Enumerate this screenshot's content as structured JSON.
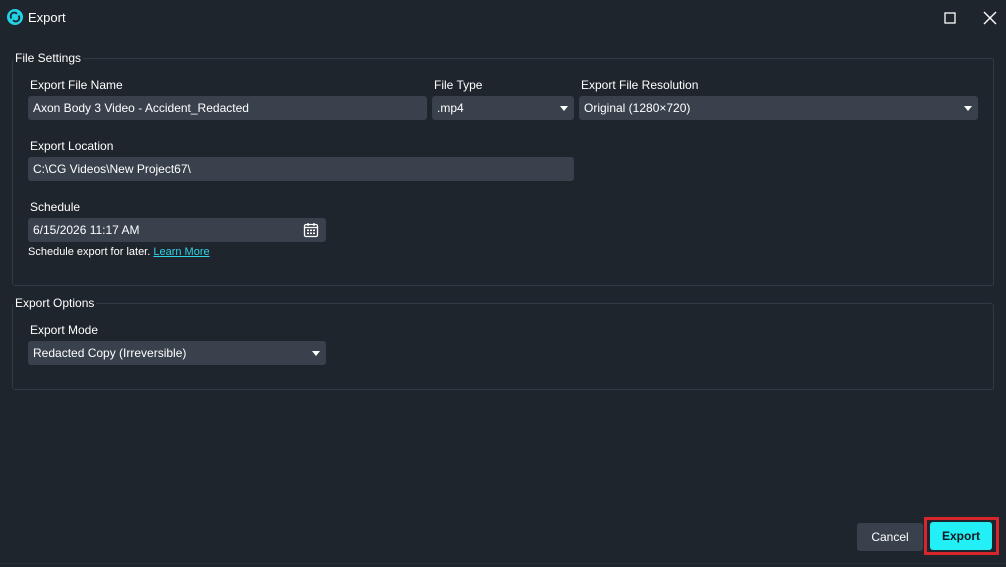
{
  "window": {
    "title": "Export",
    "icon": "app-logo-icon",
    "accent": "#22f0f6"
  },
  "file_settings": {
    "legend": "File Settings",
    "file_name_label": "Export File Name",
    "file_name_value": "Axon Body 3 Video - Accident_Redacted",
    "file_type_label": "File Type",
    "file_type_value": ".mp4",
    "resolution_label": "Export File Resolution",
    "resolution_value": "Original (1280×720)",
    "location_label": "Export Location",
    "location_value": "C:\\CG Videos\\New Project67\\",
    "schedule_label": "Schedule",
    "schedule_value": "6/15/2026 11:17 AM",
    "schedule_hint": "Schedule export for later.",
    "learn_more": "Learn More"
  },
  "export_options": {
    "legend": "Export Options",
    "mode_label": "Export Mode",
    "mode_value": "Redacted Copy (Irreversible)"
  },
  "actions": {
    "cancel": "Cancel",
    "export": "Export",
    "highlight_color": "#d7262e"
  }
}
